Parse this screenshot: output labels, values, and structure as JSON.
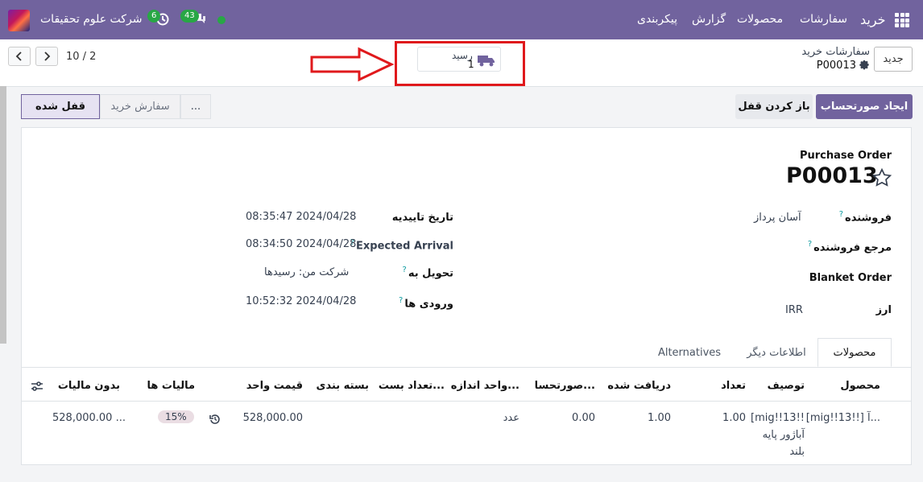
{
  "topbar": {
    "app_name": "خرید",
    "menu": [
      "سفارشات",
      "محصولات",
      "گزارش",
      "پیکربندی"
    ],
    "company": "شرکت علوم تحقیقات",
    "chat_count": "43",
    "activity_count": "6"
  },
  "control": {
    "pager": "10 / 2",
    "smart_button": {
      "label": "رسید",
      "count": "1"
    },
    "breadcrumb_parent": "سفارشات خرید",
    "record_name": "P00013",
    "new_label": "جدید"
  },
  "actions": {
    "create_bill": "ایجاد صورتحساب",
    "unlock": "باز کردن قفل"
  },
  "statusbar": {
    "locked": "قفل شده",
    "purchase_order": "سفارش خرید",
    "more": "..."
  },
  "form": {
    "doc_type": "Purchase Order",
    "name": "P00013",
    "vendor_label": "فروشنده",
    "vendor_value": "آسان پرداز",
    "vendor_ref_label": "مرجع فروشنده",
    "blanket_label": "Blanket Order",
    "currency_label": "ارز",
    "currency_value": "IRR",
    "confirm_date_label": "تاریخ تاییدیه",
    "confirm_date_value": "08:35:47 2024/04/28",
    "expected_label": "Expected Arrival",
    "expected_value": "08:34:50 2024/04/28",
    "deliver_label": "تحویل به",
    "deliver_value": "شرکت من: رسیدها",
    "receipt_label": "ورودی ها",
    "receipt_value": "10:52:32 2024/04/28"
  },
  "tabs": [
    "محصولات",
    "اطلاعات دیگر",
    "Alternatives"
  ],
  "table": {
    "headers": [
      "محصول",
      "توصیف",
      "تعداد",
      "دریافت شده",
      "صورتحسا...",
      "واحد اندازه...",
      "تعداد بست...",
      "بسته بندی",
      "قیمت واحد",
      "مالیات ها",
      "بدون مالیات"
    ],
    "row": {
      "product": "[mig!!13!!] آ...",
      "description_1": "[mig!!13!!",
      "description_2": "آباژور پایه",
      "description_3": "بلند",
      "qty": "1.00",
      "received": "1.00",
      "billed": "0.00",
      "uom": "عدد",
      "unit_price": "528,000.00",
      "tax": "15%",
      "subtotal": "528,000.00 ..."
    }
  },
  "colors": {
    "brand": "#71639e",
    "annotation": "#e0191c",
    "badge": "#28a745"
  }
}
